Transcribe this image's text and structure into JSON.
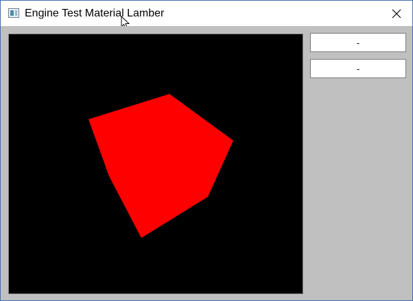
{
  "window": {
    "title": "Engine Test Material Lamber",
    "app_icon": "app-window-icon",
    "close_icon": "close-icon"
  },
  "side_panel": {
    "buttons": [
      {
        "label": "-"
      },
      {
        "label": "-"
      }
    ]
  },
  "viewport": {
    "background": "#000000",
    "mesh_color": "#ff0000"
  },
  "colors": {
    "client_background": "#c0c0c0",
    "titlebar_background": "#ffffff",
    "window_border": "#3c6fb4"
  }
}
